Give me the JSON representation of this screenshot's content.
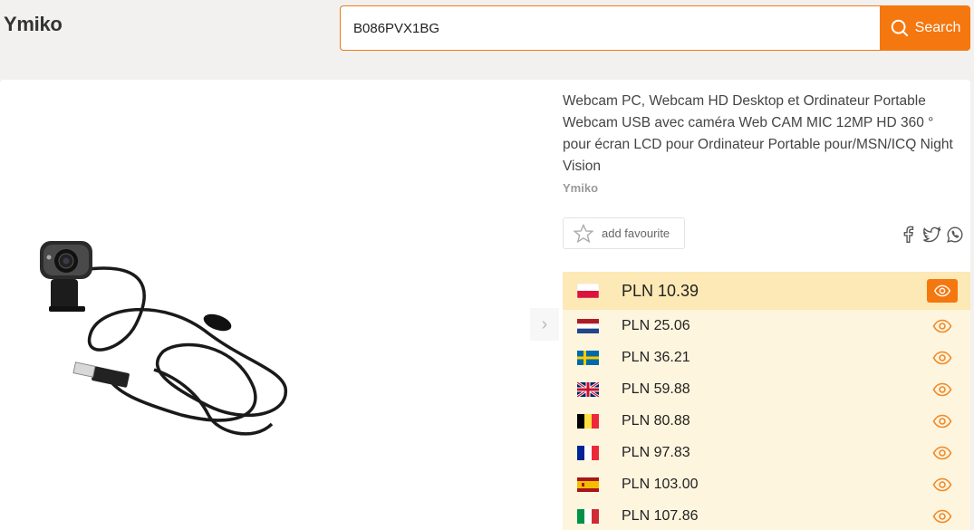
{
  "header": {
    "logo": "Ymiko",
    "search": {
      "value": "B086PVX1BG",
      "button_label": "Search"
    }
  },
  "product": {
    "title": "Webcam PC, Webcam HD Desktop et Ordinateur Portable Webcam USB avec caméra Web CAM MIC 12MP HD 360 ° pour écran LCD pour Ordinateur Portable pour/MSN/ICQ Night Vision",
    "brand": "Ymiko",
    "favourite_label": "add favourite",
    "share_icons": [
      "facebook-icon",
      "twitter-icon",
      "whatsapp-icon"
    ]
  },
  "prices": [
    {
      "country": "Poland",
      "flag": "pl",
      "price": "PLN 10.39",
      "best": true
    },
    {
      "country": "Netherlands",
      "flag": "nl",
      "price": "PLN 25.06",
      "best": false
    },
    {
      "country": "Sweden",
      "flag": "se",
      "price": "PLN 36.21",
      "best": false
    },
    {
      "country": "United Kingdom",
      "flag": "gb",
      "price": "PLN 59.88",
      "best": false
    },
    {
      "country": "Belgium",
      "flag": "be",
      "price": "PLN 80.88",
      "best": false
    },
    {
      "country": "France",
      "flag": "fr",
      "price": "PLN 97.83",
      "best": false
    },
    {
      "country": "Spain",
      "flag": "es",
      "price": "PLN 103.00",
      "best": false
    },
    {
      "country": "Italy",
      "flag": "it",
      "price": "PLN 107.86",
      "best": false
    }
  ],
  "colors": {
    "accent": "#f5770f",
    "best_row": "#fde9b6",
    "row": "#fdf5de"
  }
}
